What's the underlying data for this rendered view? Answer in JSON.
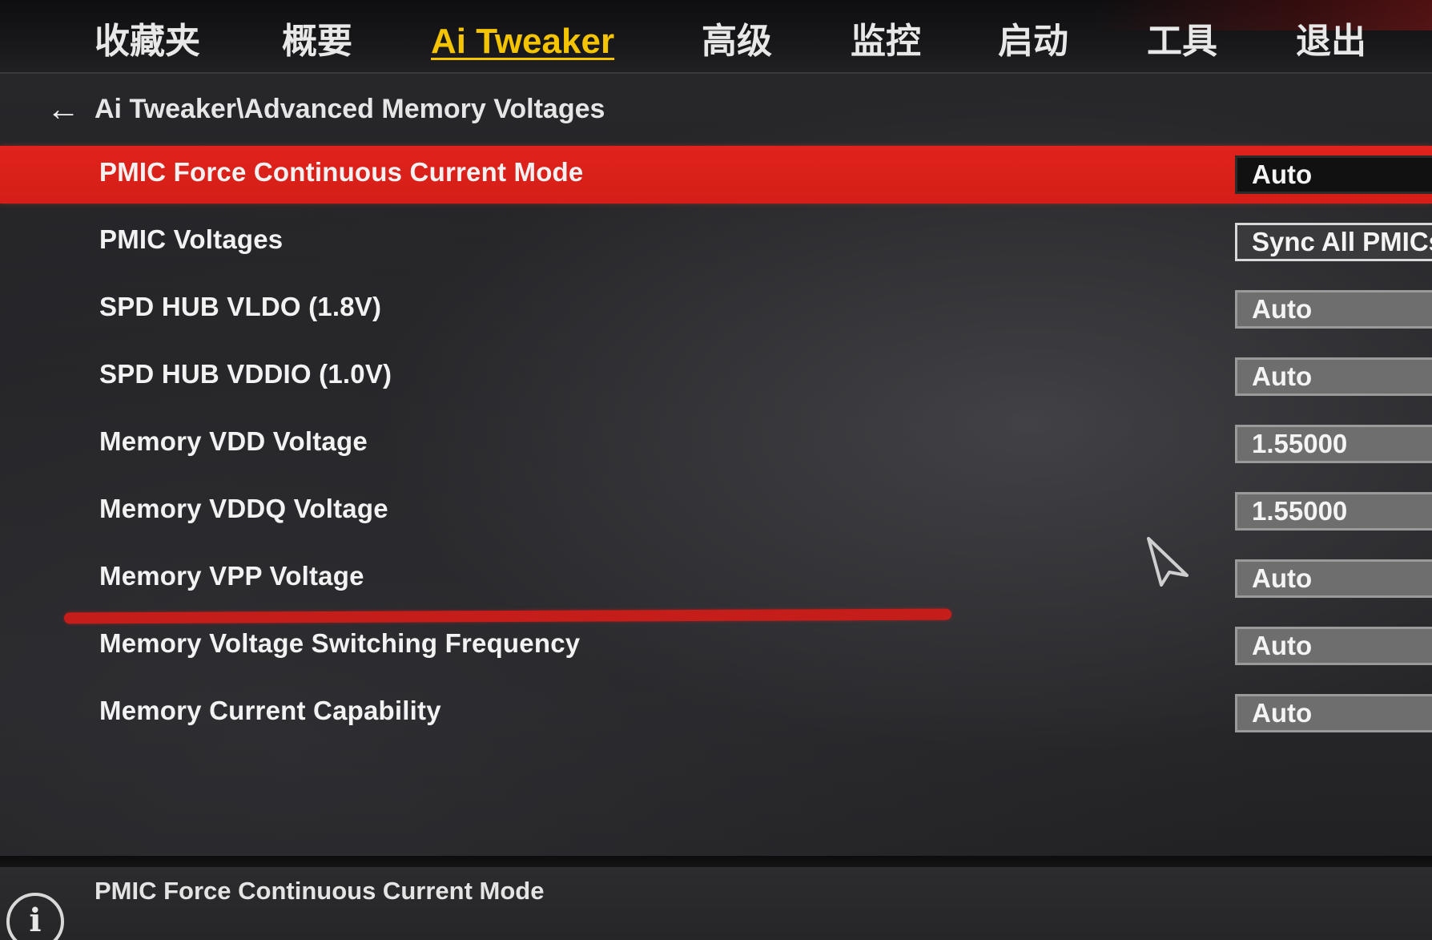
{
  "menu": {
    "tabs": [
      {
        "label": "收藏夹"
      },
      {
        "label": "概要"
      },
      {
        "label": "Ai Tweaker"
      },
      {
        "label": "高级"
      },
      {
        "label": "监控"
      },
      {
        "label": "启动"
      },
      {
        "label": "工具"
      },
      {
        "label": "退出"
      }
    ],
    "active_tab": "Ai Tweaker",
    "active_color": "#f5c400"
  },
  "breadcrumb": {
    "back_icon": "back-arrow-icon",
    "path": "Ai Tweaker\\Advanced Memory Voltages"
  },
  "settings": [
    {
      "label": "PMIC Force Continuous Current Mode",
      "value": "Auto",
      "selected": true
    },
    {
      "label": "PMIC Voltages",
      "value": "Sync All PMICs"
    },
    {
      "label": "SPD HUB VLDO (1.8V)",
      "value": "Auto"
    },
    {
      "label": "SPD HUB VDDIO (1.0V)",
      "value": "Auto"
    },
    {
      "label": "Memory VDD Voltage",
      "value": "1.55000"
    },
    {
      "label": "Memory VDDQ Voltage",
      "value": "1.55000"
    },
    {
      "label": "Memory VPP Voltage",
      "value": "Auto"
    },
    {
      "label": "Memory Voltage Switching Frequency",
      "value": "Auto"
    },
    {
      "label": "Memory Current Capability",
      "value": "Auto"
    }
  ],
  "colors": {
    "selection": "#e0231c",
    "marker": "#c51e1a"
  },
  "help": {
    "icon": "info-icon",
    "text": "PMIC Force Continuous Current Mode"
  }
}
